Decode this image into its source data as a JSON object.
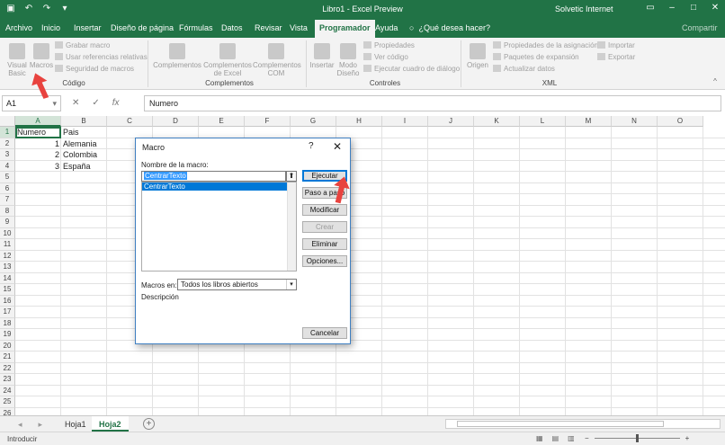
{
  "titlebar": {
    "title": "Libro1 - Excel Preview",
    "user": "Solvetic Internet"
  },
  "tabs": [
    "Archivo",
    "Inicio",
    "Insertar",
    "Diseño de página",
    "Fórmulas",
    "Datos",
    "Revisar",
    "Vista",
    "Programador",
    "Ayuda"
  ],
  "active_tab": "Programador",
  "tellme": "¿Qué desea hacer?",
  "share": "Compartir",
  "ribbon": {
    "codigo": {
      "label": "Código",
      "visual_basic": "Visual Basic",
      "macros": "Macros",
      "grabar": "Grabar macro",
      "referencias": "Usar referencias relativas",
      "seguridad": "Seguridad de macros"
    },
    "complementos": {
      "label": "Complementos",
      "comp": "Complementos",
      "comp_excel": "Complementos de Excel",
      "comp_com": "Complementos COM"
    },
    "controles": {
      "label": "Controles",
      "insertar": "Insertar",
      "modo": "Modo Diseño",
      "propiedades": "Propiedades",
      "ver_codigo": "Ver código",
      "ejecutar_cuadro": "Ejecutar cuadro de diálogo"
    },
    "xml": {
      "label": "XML",
      "origen": "Origen",
      "prop_asig": "Propiedades de la asignación",
      "paquetes": "Paquetes de expansión",
      "actualizar": "Actualizar datos",
      "importar": "Importar",
      "exportar": "Exportar"
    }
  },
  "formula_bar": {
    "name_box": "A1",
    "value": "Numero"
  },
  "columns": [
    "A",
    "B",
    "C",
    "D",
    "E",
    "F",
    "G",
    "H",
    "I",
    "J",
    "K",
    "L",
    "M",
    "N",
    "O"
  ],
  "rows": [
    "1",
    "2",
    "3",
    "4",
    "5",
    "6",
    "7",
    "8",
    "9",
    "10",
    "11",
    "12",
    "13",
    "14",
    "15",
    "16",
    "17",
    "18",
    "19",
    "20",
    "21",
    "22",
    "23",
    "24",
    "25",
    "26"
  ],
  "cells": {
    "a1": "Numero",
    "b1": "Pais",
    "a2": "1",
    "b2": "Alemania",
    "a3": "2",
    "b3": "Colombia",
    "a4": "3",
    "b4": "España"
  },
  "sheets": [
    "Hoja1",
    "Hoja2"
  ],
  "active_sheet": "Hoja2",
  "status": {
    "mode": "Introducir",
    "zoom_minus": "−",
    "zoom_plus": "+"
  },
  "dialog": {
    "title": "Macro",
    "help": "?",
    "close": "✕",
    "name_label": "Nombre de la macro:",
    "name_value": "CentrarTexto",
    "list": [
      "CentrarTexto"
    ],
    "buttons": {
      "ejecutar": "Ejecutar",
      "paso": "Paso a paso",
      "modificar": "Modificar",
      "crear": "Crear",
      "eliminar": "Eliminar",
      "opciones": "Opciones...",
      "cancelar": "Cancelar"
    },
    "macros_en_label": "Macros en:",
    "macros_en_value": "Todos los libros abiertos",
    "descripcion_label": "Descripción"
  },
  "colors": {
    "excel_green": "#217346",
    "arrow_red": "#e8433f",
    "dialog_border": "#3f7fc1"
  }
}
